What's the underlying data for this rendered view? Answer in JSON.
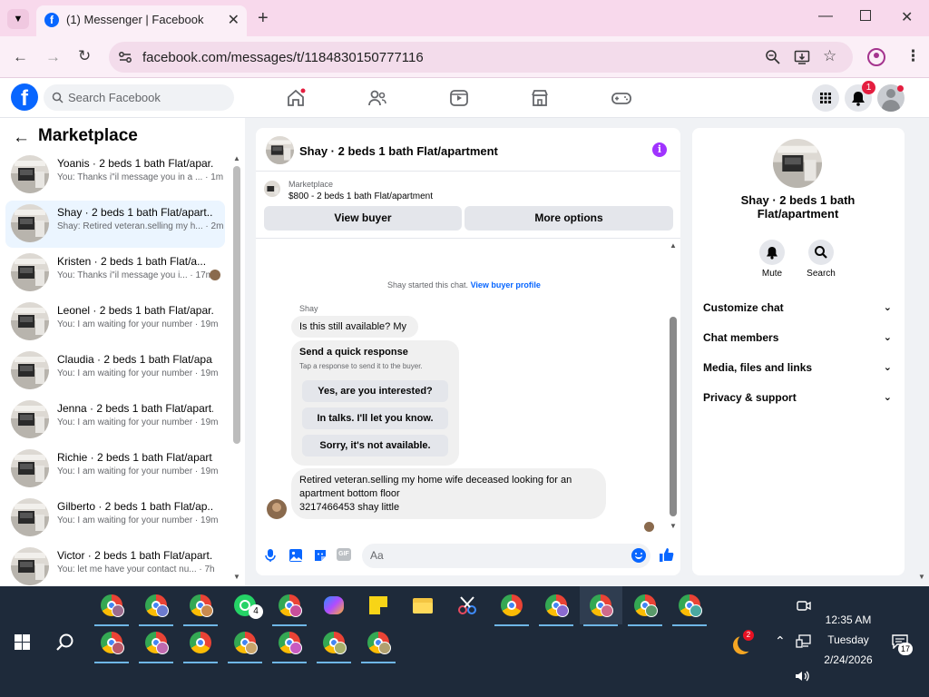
{
  "browser": {
    "tab_title": "(1) Messenger | Facebook",
    "url": "facebook.com/messages/t/1184830150777116"
  },
  "fb": {
    "search_placeholder": "Search Facebook",
    "notification_count": "1"
  },
  "left": {
    "title": "Marketplace",
    "conversations": [
      {
        "name": "Yoanis · 2 beds 1 bath Flat/apar...",
        "preview": "You: Thanks i\"il message you in a ... · 1m"
      },
      {
        "name": "Shay · 2 beds 1 bath Flat/apart...",
        "preview": "Shay: Retired veteran.selling my h... · 2m"
      },
      {
        "name": "Kristen · 2 beds 1 bath Flat/a...",
        "preview": "You: Thanks i\"il message you i... · 17m"
      },
      {
        "name": "Leonel · 2 beds 1 bath Flat/apar...",
        "preview": "You: I am waiting for your number · 19m"
      },
      {
        "name": "Claudia · 2 beds 1 bath Flat/apa...",
        "preview": "You: I am waiting for your number · 19m"
      },
      {
        "name": "Jenna · 2 beds 1 bath Flat/apart...",
        "preview": "You: I am waiting for your number · 19m"
      },
      {
        "name": "Richie · 2 beds 1 bath Flat/apart...",
        "preview": "You: I am waiting for your number · 19m"
      },
      {
        "name": "Gilberto · 2 beds 1 bath Flat/ap...",
        "preview": "You: I am waiting for your number · 19m"
      },
      {
        "name": "Victor · 2 beds 1 bath Flat/apart...",
        "preview": "You: let me have your contact nu... · 7h"
      }
    ]
  },
  "chat": {
    "header_title": "Shay · 2 beds 1 bath Flat/apartment",
    "marketplace_label": "Marketplace",
    "listing": "$800 - 2 beds 1 bath Flat/apartment",
    "view_buyer": "View buyer",
    "more_options": "More options",
    "started_text": "Shay started this chat.",
    "view_buyer_profile": "View buyer profile",
    "sender": "Shay",
    "msg1": "Is this still available? My",
    "qr_title": "Send a quick response",
    "qr_sub": "Tap a response to send it to the buyer.",
    "qr_options": [
      "Yes, are you interested?",
      "In talks. I'll let you know.",
      "Sorry, it's not available."
    ],
    "msg2_line1": "Retired veteran.selling my home wife deceased looking for an",
    "msg2_line2": "apartment bottom floor",
    "msg2_line3": "3217466453 shay little",
    "composer_placeholder": "Aa"
  },
  "info": {
    "title": "Shay · 2 beds 1 bath Flat/apartment",
    "mute": "Mute",
    "search": "Search",
    "sections": [
      "Customize chat",
      "Chat members",
      "Media, files and links",
      "Privacy & support"
    ]
  },
  "taskbar": {
    "time": "12:35 AM",
    "day": "Tuesday",
    "date": "2/24/2026",
    "whatsapp_badge": "4",
    "weather_badge": "2",
    "notif_count": "17"
  }
}
